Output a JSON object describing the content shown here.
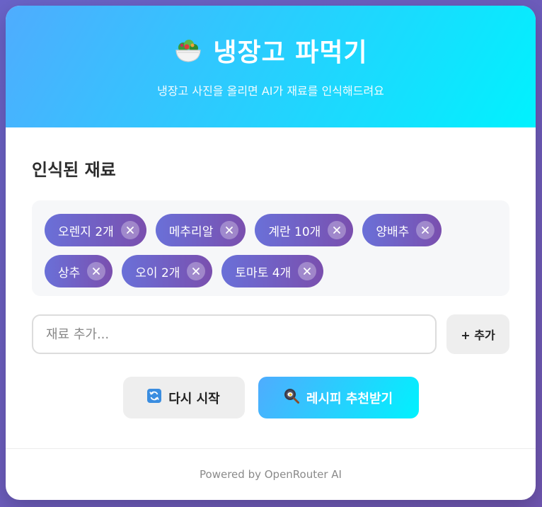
{
  "header": {
    "icon": "salad-bowl-icon",
    "title": "냉장고 파먹기",
    "subtitle": "냉장고 사진을 올리면 AI가 재료를 인식해드려요",
    "gradient": [
      "#4facfe",
      "#00f2fe"
    ]
  },
  "ingredients": {
    "section_title": "인식된 재료",
    "items": [
      {
        "label": "오렌지 2개"
      },
      {
        "label": "메추리알"
      },
      {
        "label": "계란 10개"
      },
      {
        "label": "양배추"
      },
      {
        "label": "상추"
      },
      {
        "label": "오이 2개"
      },
      {
        "label": "토마토 4개"
      }
    ],
    "remove_icon": "close-icon",
    "tag_colors": [
      "#6a70d8",
      "#7a4fae"
    ]
  },
  "add_form": {
    "placeholder": "재료 추가...",
    "value": "",
    "add_label": "+ 추가"
  },
  "actions": {
    "restart_icon": "refresh-icon",
    "restart_label": "다시 시작",
    "recipe_icon": "cooking-pan-icon",
    "recipe_label": "레시피 추천받기"
  },
  "footer": {
    "text": "Powered by OpenRouter AI"
  }
}
